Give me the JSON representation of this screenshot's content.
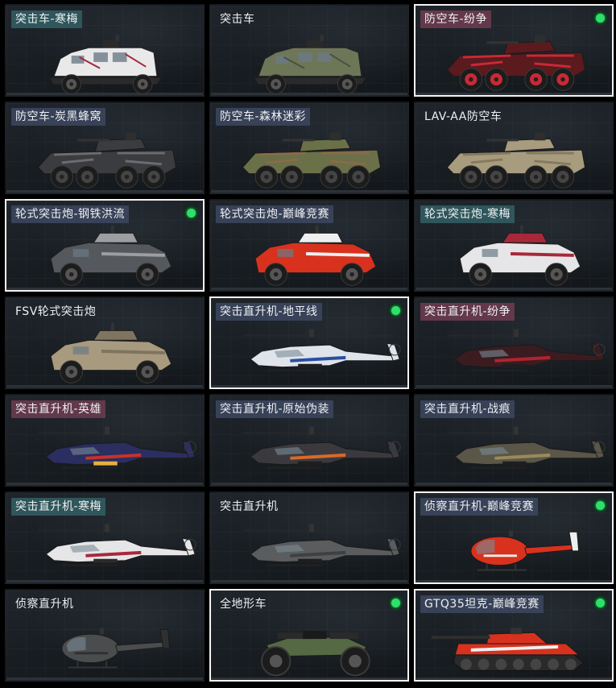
{
  "items": [
    {
      "name": "突击车-寒梅",
      "tagged": true,
      "tag_color": "teal",
      "selected": false,
      "owned": false,
      "kind": "apc",
      "palette": [
        "#e9e9ea",
        "#a02838",
        "#2a2a2a"
      ]
    },
    {
      "name": "突击车",
      "tagged": false,
      "selected": false,
      "owned": false,
      "kind": "apc",
      "palette": [
        "#6e7658",
        "#4a5040",
        "#2a2a2a"
      ]
    },
    {
      "name": "防空车-纷争",
      "tagged": true,
      "tag_color": "red",
      "selected": true,
      "owned": true,
      "kind": "aa",
      "palette": [
        "#5a1a1e",
        "#c82a35",
        "#2a2a2a"
      ]
    },
    {
      "name": "防空车-炭黑蜂窝",
      "tagged": true,
      "tag_color": "slate",
      "selected": false,
      "owned": false,
      "kind": "aa",
      "palette": [
        "#3a3c40",
        "#6a6c70",
        "#1e1e20"
      ]
    },
    {
      "name": "防空车-森林迷彩",
      "tagged": true,
      "tag_color": "slate",
      "selected": false,
      "owned": false,
      "kind": "aa",
      "palette": [
        "#6a7048",
        "#8a6a4a",
        "#2a2a2a"
      ]
    },
    {
      "name": "LAV-AA防空车",
      "tagged": false,
      "selected": false,
      "owned": false,
      "kind": "aa",
      "palette": [
        "#a89c7e",
        "#857a60",
        "#2a2a2a"
      ]
    },
    {
      "name": "轮式突击炮-钢铁洪流",
      "tagged": true,
      "tag_color": "slate",
      "selected": true,
      "owned": true,
      "kind": "armored",
      "palette": [
        "#55585c",
        "#9c9ea2",
        "#1e1e20"
      ]
    },
    {
      "name": "轮式突击炮-巅峰竞赛",
      "tagged": true,
      "tag_color": "slate",
      "selected": false,
      "owned": false,
      "kind": "armored",
      "palette": [
        "#d8321e",
        "#efefef",
        "#1e1e20"
      ]
    },
    {
      "name": "轮式突击炮-寒梅",
      "tagged": true,
      "tag_color": "teal",
      "selected": false,
      "owned": false,
      "kind": "armored",
      "palette": [
        "#e6e6e8",
        "#a8283a",
        "#2a2a2a"
      ]
    },
    {
      "name": "FSV轮式突击炮",
      "tagged": false,
      "selected": false,
      "owned": false,
      "kind": "armored",
      "palette": [
        "#a89a7e",
        "#7e7460",
        "#2a2a2a"
      ]
    },
    {
      "name": "突击直升机-地平线",
      "tagged": true,
      "tag_color": "slate",
      "selected": true,
      "owned": true,
      "kind": "attack-heli",
      "palette": [
        "#dfe3ea",
        "#2a4fa0",
        "#1e1e20"
      ]
    },
    {
      "name": "突击直升机-纷争",
      "tagged": true,
      "tag_color": "red",
      "selected": false,
      "owned": false,
      "kind": "attack-heli",
      "palette": [
        "#3a1c20",
        "#b02430",
        "#1e1e20"
      ]
    },
    {
      "name": "突击直升机-英雄",
      "tagged": true,
      "tag_color": "red",
      "selected": false,
      "owned": false,
      "kind": "attack-heli",
      "palette": [
        "#2a2e60",
        "#c83228",
        "#e6b040"
      ]
    },
    {
      "name": "突击直升机-原始伪装",
      "tagged": true,
      "tag_color": "slate",
      "selected": false,
      "owned": false,
      "kind": "attack-heli",
      "palette": [
        "#3a3a3e",
        "#d86a28",
        "#1e1e20"
      ]
    },
    {
      "name": "突击直升机-战痕",
      "tagged": true,
      "tag_color": "slate",
      "selected": false,
      "owned": false,
      "kind": "attack-heli",
      "palette": [
        "#5a5648",
        "#9a8a5a",
        "#1e1e20"
      ]
    },
    {
      "name": "突击直升机-寒梅",
      "tagged": true,
      "tag_color": "teal",
      "selected": false,
      "owned": false,
      "kind": "attack-heli",
      "palette": [
        "#e6e6e8",
        "#a8283a",
        "#2a2a2a"
      ]
    },
    {
      "name": "突击直升机",
      "tagged": false,
      "selected": false,
      "owned": false,
      "kind": "attack-heli",
      "palette": [
        "#5a5c5e",
        "#3e4042",
        "#1e1e20"
      ]
    },
    {
      "name": "侦察直升机-巅峰竞赛",
      "tagged": true,
      "tag_color": "slate",
      "selected": true,
      "owned": true,
      "kind": "scout-heli",
      "palette": [
        "#d8321e",
        "#efefef",
        "#1e1e20"
      ]
    },
    {
      "name": "侦察直升机",
      "tagged": false,
      "selected": false,
      "owned": false,
      "kind": "scout-heli",
      "palette": [
        "#4a4c4e",
        "#2e3032",
        "#1e1e20"
      ]
    },
    {
      "name": "全地形车",
      "tagged": false,
      "selected": true,
      "owned": true,
      "kind": "atv",
      "palette": [
        "#556a44",
        "#3a4a30",
        "#1e1e20"
      ]
    },
    {
      "name": "GTQ35坦克-巅峰竞赛",
      "tagged": true,
      "tag_color": "slate",
      "selected": true,
      "owned": true,
      "kind": "tank",
      "palette": [
        "#d8321e",
        "#efefef",
        "#2a2a2a"
      ]
    }
  ]
}
